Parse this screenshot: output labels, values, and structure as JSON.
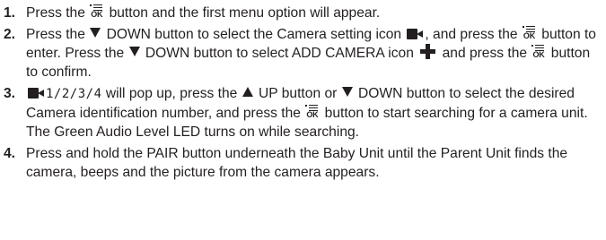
{
  "steps": [
    {
      "number": "1.",
      "parts": {
        "a": "Press the",
        "b": "button and the first menu option will appear."
      }
    },
    {
      "number": "2.",
      "parts": {
        "a": "Press the",
        "b": "DOWN button to select the Camera setting icon",
        "c": ", and",
        "d": "press the",
        "e": "button to enter. Press the",
        "f": "DOWN button to select ADD",
        "g": "CAMERA icon",
        "h": "and press the",
        "i": "button to confirm."
      }
    },
    {
      "number": "3.",
      "parts": {
        "seg": "1/2/3/4",
        "a": "will pop up, press the",
        "b": "UP button or",
        "c": "DOWN button to",
        "d": "select the desired Camera identification number, and press the",
        "e": "button",
        "f": "to start searching for a camera unit. The Green Audio Level LED turns on while searching."
      }
    },
    {
      "number": "4.",
      "parts": {
        "a": "Press and hold the PAIR button underneath the Baby Unit until the Parent Unit finds the camera, beeps and the picture from the camera appears."
      }
    }
  ],
  "icons": {
    "ok_label": "OK"
  }
}
